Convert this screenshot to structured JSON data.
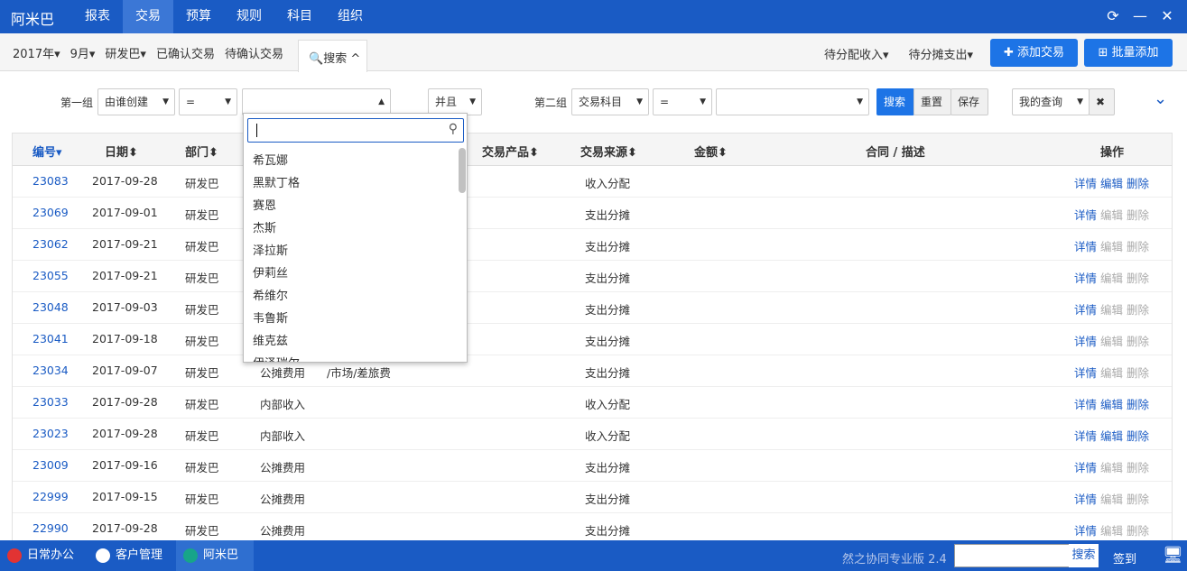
{
  "app": {
    "brand": "阿米巴"
  },
  "nav": [
    "报表",
    "交易",
    "预算",
    "规则",
    "科目",
    "组织"
  ],
  "topicons": [
    "refresh-icon",
    "minimize-icon",
    "close-icon"
  ],
  "subbar": {
    "left": [
      "2017年▾",
      "9月▾",
      "研发巴▾",
      "已确认交易",
      "待确认交易"
    ],
    "search_tab": "搜索",
    "right": [
      "待分配收入▾",
      "待分摊支出▾"
    ],
    "add_btn": "添加交易",
    "batch_btn": "批量添加"
  },
  "filters": {
    "group1_label": "第一组",
    "group1_field": "由谁创建",
    "op1": "=",
    "and": "并且",
    "group2_label": "第二组",
    "group2_field": "交易科目",
    "op2": "=",
    "search": "搜索",
    "reset": "重置",
    "save": "保存",
    "myquery": "我的查询"
  },
  "table": {
    "headers": [
      "编号▾",
      "日期⬍",
      "部门⬍",
      "交易产品⬍",
      "交易来源⬍",
      "金额⬍",
      "合同 / 描述",
      "操作"
    ],
    "rows": [
      {
        "id": "23083",
        "date": "2017-09-28",
        "dept": "研发巴",
        "type": "",
        "prod": "",
        "src": "收入分配",
        "ops": [
          true,
          true,
          true
        ]
      },
      {
        "id": "23069",
        "date": "2017-09-01",
        "dept": "研发巴",
        "type": "",
        "prod": "",
        "src": "支出分摊",
        "ops": [
          true,
          false,
          false
        ]
      },
      {
        "id": "23062",
        "date": "2017-09-21",
        "dept": "研发巴",
        "type": "",
        "prod": "",
        "src": "支出分摊",
        "ops": [
          true,
          false,
          false
        ]
      },
      {
        "id": "23055",
        "date": "2017-09-21",
        "dept": "研发巴",
        "type": "",
        "prod": "",
        "src": "支出分摊",
        "ops": [
          true,
          false,
          false
        ]
      },
      {
        "id": "23048",
        "date": "2017-09-03",
        "dept": "研发巴",
        "type": "",
        "prod": "",
        "src": "支出分摊",
        "ops": [
          true,
          false,
          false
        ]
      },
      {
        "id": "23041",
        "date": "2017-09-18",
        "dept": "研发巴",
        "type": "",
        "prod": "",
        "src": "支出分摊",
        "ops": [
          true,
          false,
          false
        ]
      },
      {
        "id": "23034",
        "date": "2017-09-07",
        "dept": "研发巴",
        "type": "公摊费用",
        "prod": "/市场/差旅费",
        "src": "支出分摊",
        "ops": [
          true,
          false,
          false
        ]
      },
      {
        "id": "23033",
        "date": "2017-09-28",
        "dept": "研发巴",
        "type": "内部收入",
        "prod": "",
        "src": "收入分配",
        "ops": [
          true,
          true,
          true
        ]
      },
      {
        "id": "23023",
        "date": "2017-09-28",
        "dept": "研发巴",
        "type": "内部收入",
        "prod": "",
        "src": "收入分配",
        "ops": [
          true,
          true,
          true
        ]
      },
      {
        "id": "23009",
        "date": "2017-09-16",
        "dept": "研发巴",
        "type": "公摊费用",
        "prod": "",
        "src": "支出分摊",
        "ops": [
          true,
          false,
          false
        ]
      },
      {
        "id": "22999",
        "date": "2017-09-15",
        "dept": "研发巴",
        "type": "公摊费用",
        "prod": "",
        "src": "支出分摊",
        "ops": [
          true,
          false,
          false
        ]
      },
      {
        "id": "22990",
        "date": "2017-09-28",
        "dept": "研发巴",
        "type": "公摊费用",
        "prod": "",
        "src": "支出分摊",
        "ops": [
          true,
          false,
          false
        ]
      }
    ],
    "ops_labels": [
      "详情",
      "编辑",
      "删除"
    ]
  },
  "dropdown": {
    "options": [
      "希瓦娜",
      "黑默丁格",
      "赛恩",
      "杰斯",
      "泽拉斯",
      "伊莉丝",
      "希维尔",
      "韦鲁斯",
      "维克兹",
      "伊泽瑞尔"
    ]
  },
  "footer": {
    "tasks": [
      "日常办公",
      "客户管理",
      "阿米巴"
    ],
    "version": "然之协同专业版 2.4",
    "search_btn": "搜索",
    "signin": "签到"
  }
}
